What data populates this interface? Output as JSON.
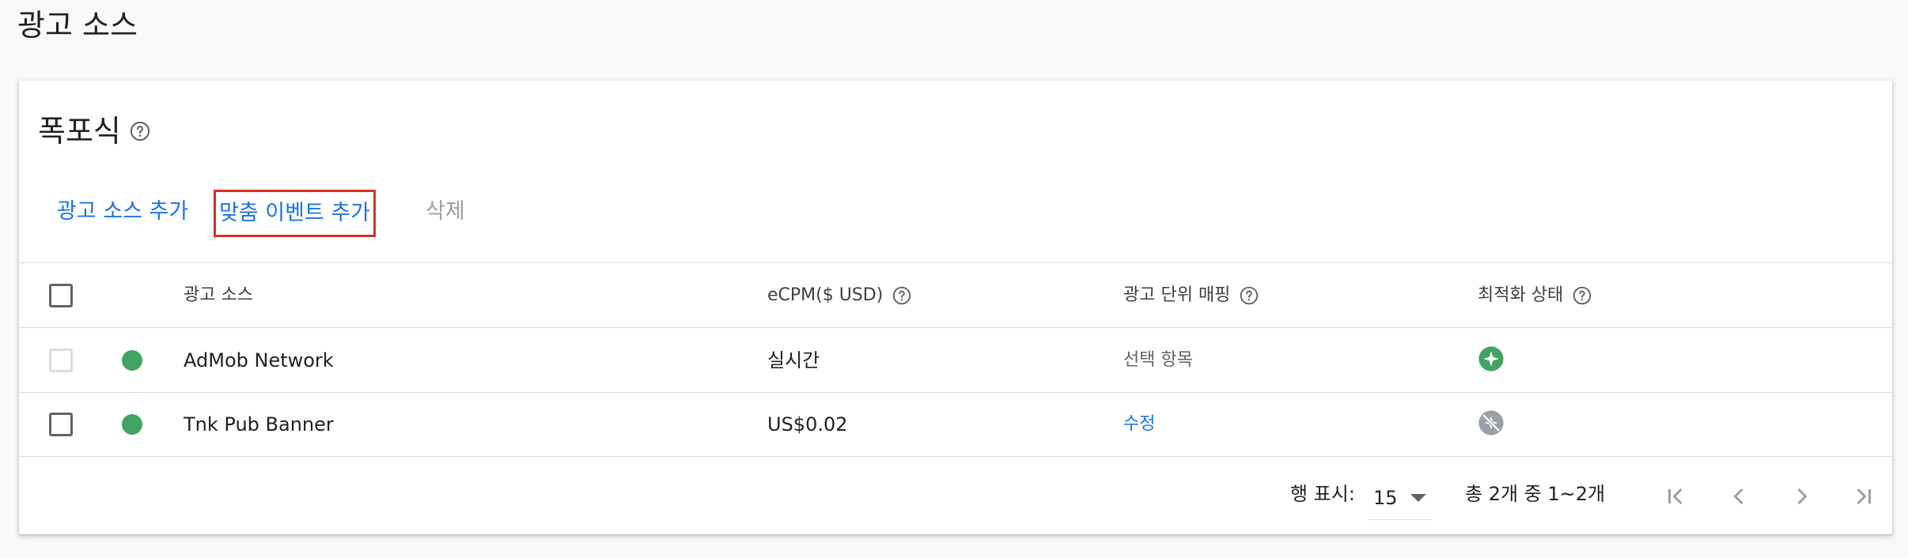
{
  "page": {
    "title": "광고 소스"
  },
  "card": {
    "title": "폭포식",
    "actions": {
      "add_source": "광고 소스 추가",
      "add_custom_event": "맞춤 이벤트 추가",
      "delete": "삭제"
    }
  },
  "table": {
    "columns": {
      "source": "광고 소스",
      "ecpm": "eCPM($ USD)",
      "mapping": "광고 단위 매핑",
      "optimization": "최적화 상태"
    },
    "rows": [
      {
        "name": "AdMob Network",
        "ecpm": "실시간",
        "mapping": "선택 항목",
        "status_icon": "optimized-sparkle-icon",
        "checkbox_disabled": true
      },
      {
        "name": "Tnk Pub Banner",
        "ecpm": "US$0.02",
        "mapping": "수정",
        "status_icon": "optimization-off-icon",
        "checkbox_disabled": false
      }
    ]
  },
  "pagination": {
    "rows_label": "행 표시:",
    "rows_value": "15",
    "range": "총 2개 중 1~2개"
  },
  "colors": {
    "accent": "#1a73e8",
    "status_active": "#43a363",
    "highlight": "#d93025"
  }
}
